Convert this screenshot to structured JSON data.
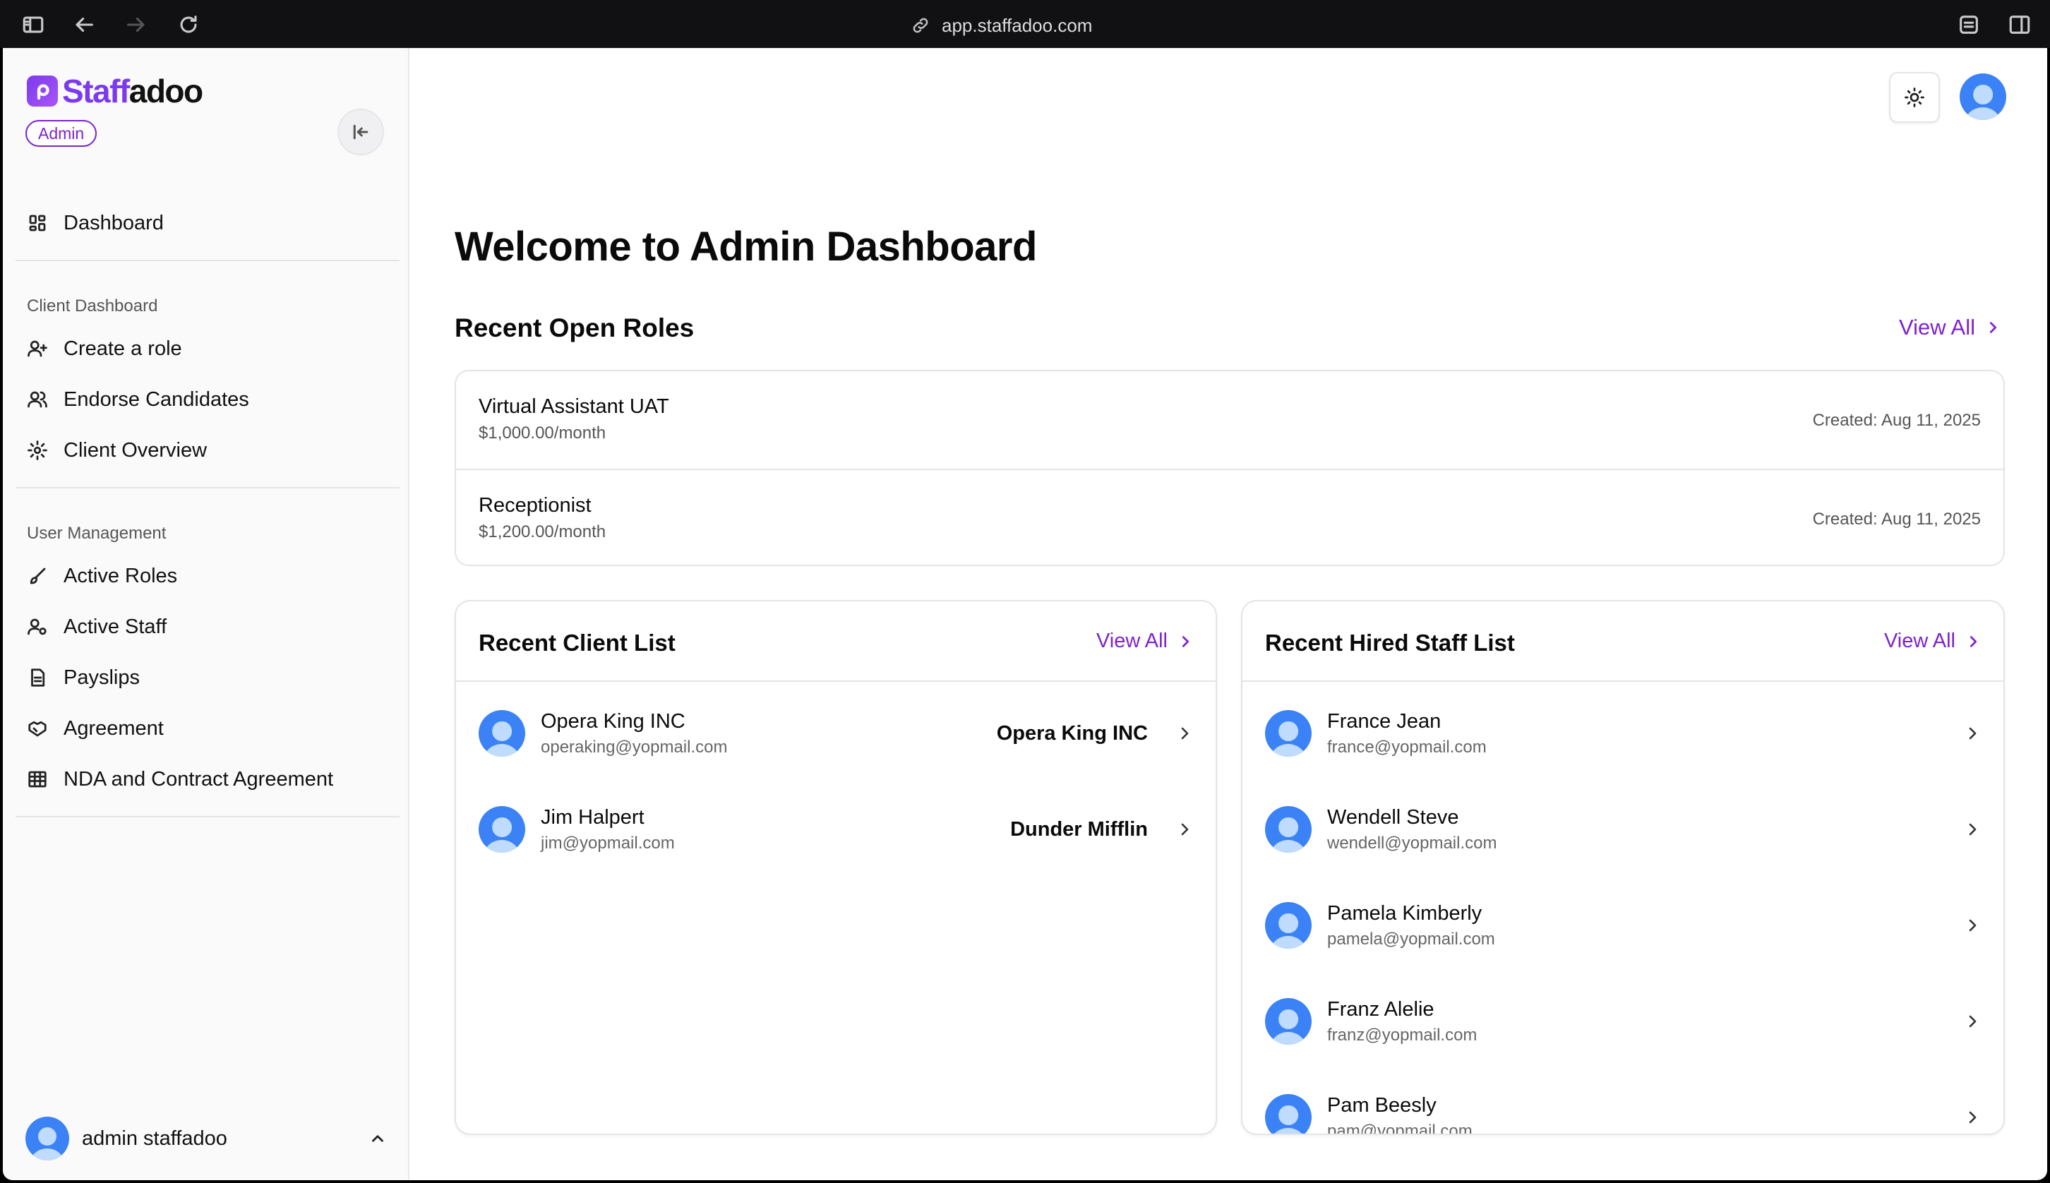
{
  "browser": {
    "url": "app.staffadoo.com"
  },
  "brand": {
    "name_part1": "Staff",
    "name_part2": "adoo",
    "role_badge": "Admin",
    "accent_color": "#7e22ce"
  },
  "sidebar": {
    "dashboard_label": "Dashboard",
    "client_section_label": "Client Dashboard",
    "client_items": [
      {
        "label": "Create a role",
        "icon": "user-plus-icon"
      },
      {
        "label": "Endorse Candidates",
        "icon": "users-icon"
      },
      {
        "label": "Client Overview",
        "icon": "gear-icon"
      }
    ],
    "user_section_label": "User Management",
    "user_items": [
      {
        "label": "Active Roles",
        "icon": "brush-icon"
      },
      {
        "label": "Active Staff",
        "icon": "user-cog-icon"
      },
      {
        "label": "Payslips",
        "icon": "document-icon"
      },
      {
        "label": "Agreement",
        "icon": "handshake-icon"
      },
      {
        "label": "NDA and Contract Agreement",
        "icon": "table-icon"
      }
    ],
    "current_user": "admin staffadoo"
  },
  "main": {
    "page_title": "Welcome to Admin Dashboard",
    "open_roles": {
      "title": "Recent Open Roles",
      "view_all": "View All",
      "roles": [
        {
          "title": "Virtual Assistant UAT",
          "salary": "$1,000.00/month",
          "created": "Created: Aug 11, 2025"
        },
        {
          "title": "Receptionist",
          "salary": "$1,200.00/month",
          "created": "Created: Aug 11, 2025"
        }
      ]
    },
    "client_list": {
      "title": "Recent Client List",
      "view_all": "View All",
      "clients": [
        {
          "name": "Opera King INC",
          "email": "operaking@yopmail.com",
          "company": "Opera King INC"
        },
        {
          "name": "Jim Halpert",
          "email": "jim@yopmail.com",
          "company": "Dunder Mifflin"
        }
      ]
    },
    "staff_list": {
      "title": "Recent Hired Staff List",
      "view_all": "View All",
      "staff": [
        {
          "name": "France Jean",
          "email": "france@yopmail.com"
        },
        {
          "name": "Wendell Steve",
          "email": "wendell@yopmail.com"
        },
        {
          "name": "Pamela Kimberly",
          "email": "pamela@yopmail.com"
        },
        {
          "name": "Franz Alelie",
          "email": "franz@yopmail.com"
        },
        {
          "name": "Pam Beesly",
          "email": "pam@yopmail.com"
        }
      ]
    }
  }
}
